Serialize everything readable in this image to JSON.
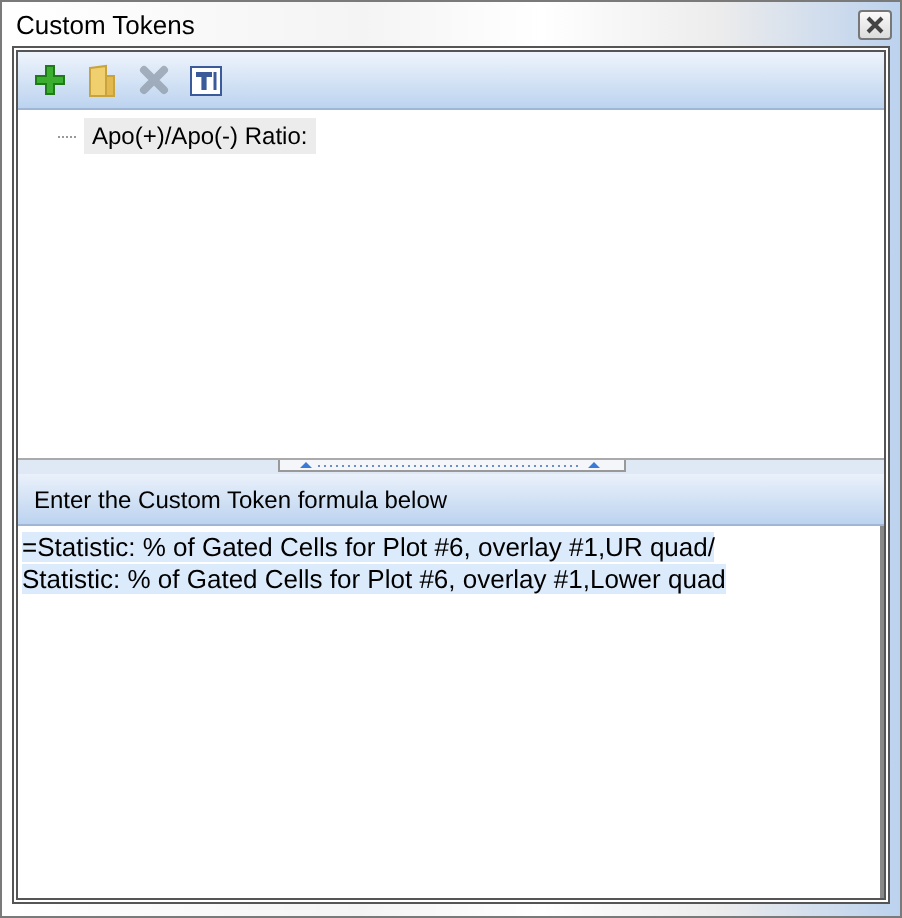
{
  "window": {
    "title": "Custom Tokens"
  },
  "toolbar": [
    {
      "kind": "add",
      "disabled": false
    },
    {
      "kind": "folder",
      "disabled": false
    },
    {
      "kind": "delete",
      "disabled": true
    },
    {
      "kind": "text",
      "disabled": false
    }
  ],
  "tree": {
    "items": [
      {
        "label": "Apo(+)/Apo(-) Ratio:",
        "selected": true
      }
    ]
  },
  "formula_label": "Enter the Custom Token formula below",
  "formula": {
    "selected": true,
    "lines": [
      "=Statistic: % of Gated Cells for Plot #6, overlay #1,UR quad/",
      "Statistic: % of Gated Cells for Plot #6, overlay #1,Lower quad"
    ]
  }
}
